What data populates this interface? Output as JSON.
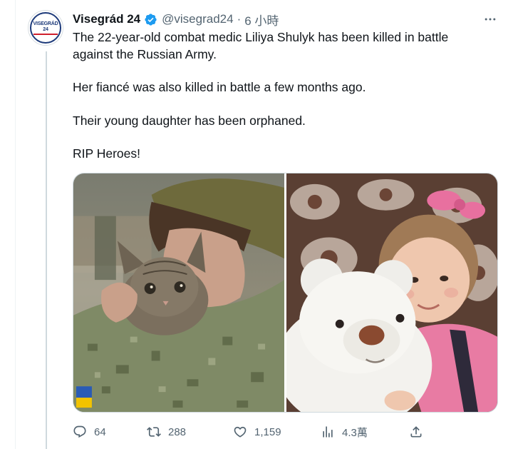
{
  "tweet": {
    "display_name": "Visegrád 24",
    "handle": "@visegrad24",
    "separator": "·",
    "time": "6 小時",
    "avatar_logo_primary": "VISEGRÁD",
    "avatar_logo_secondary": "24",
    "paragraphs": [
      "The 22-year-old combat medic Liliya Shulyk has been killed in battle against the Russian Army.",
      "Her fiancé was also killed in battle a few months ago.",
      "Their young daughter has been orphaned.",
      "RIP Heroes!"
    ],
    "more_icon": "ellipsis-icon",
    "verified_icon": "verified-badge-icon",
    "verified_color": "#1d9bf0"
  },
  "media": {
    "photos": [
      {
        "subject": "soldier-with-kitten-photo"
      },
      {
        "subject": "child-with-teddy-bear-photo"
      }
    ]
  },
  "actions": {
    "reply": {
      "icon": "reply-icon",
      "count": "64"
    },
    "retweet": {
      "icon": "retweet-icon",
      "count": "288"
    },
    "like": {
      "icon": "heart-icon",
      "count": "1,159"
    },
    "views": {
      "icon": "views-icon",
      "count": "4.3萬"
    },
    "share": {
      "icon": "share-icon"
    }
  },
  "colors": {
    "text_primary": "#0f1419",
    "text_secondary": "#536471",
    "border": "#cfd9de",
    "brand_blue": "#1d3a7a",
    "brand_red": "#d0202d"
  }
}
